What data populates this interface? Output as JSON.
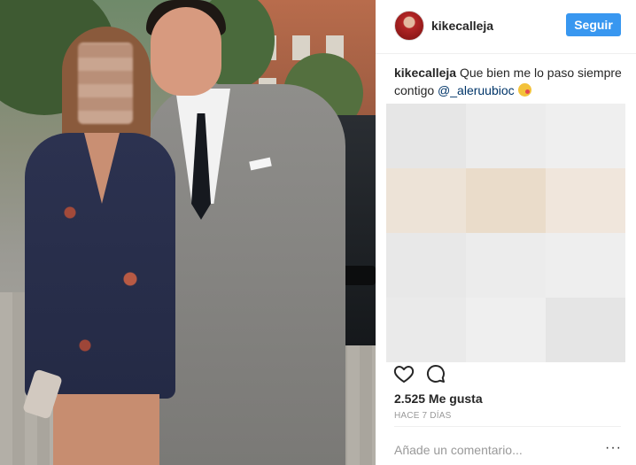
{
  "post": {
    "username": "kikecalleja",
    "follow_label": "Seguir",
    "caption_user": "kikecalleja",
    "caption_text": "Que bien me lo paso siempre contigo",
    "caption_mention": "@_aleruubioc",
    "likes": "2.525 Me gusta",
    "time_ago": "HACE 7 DÍAS",
    "comment_placeholder": "Añade un comentario...",
    "more_label": "···",
    "icons": {
      "like": "heart-icon",
      "comment": "comment-icon",
      "emoji": "kiss-emoji-icon",
      "more": "more-options-icon"
    },
    "mosaic_colors": [
      "#e6e6e6",
      "#ececec",
      "#efefef",
      "#ede3d7",
      "#eadcca",
      "#f0e6dc",
      "#e8e8e8",
      "#ececec",
      "#eeeeee",
      "#eaeaea",
      "#efefef",
      "#e5e5e5"
    ]
  },
  "colors": {
    "accent": "#3897f0",
    "mention": "#003569",
    "muted": "#999999"
  }
}
